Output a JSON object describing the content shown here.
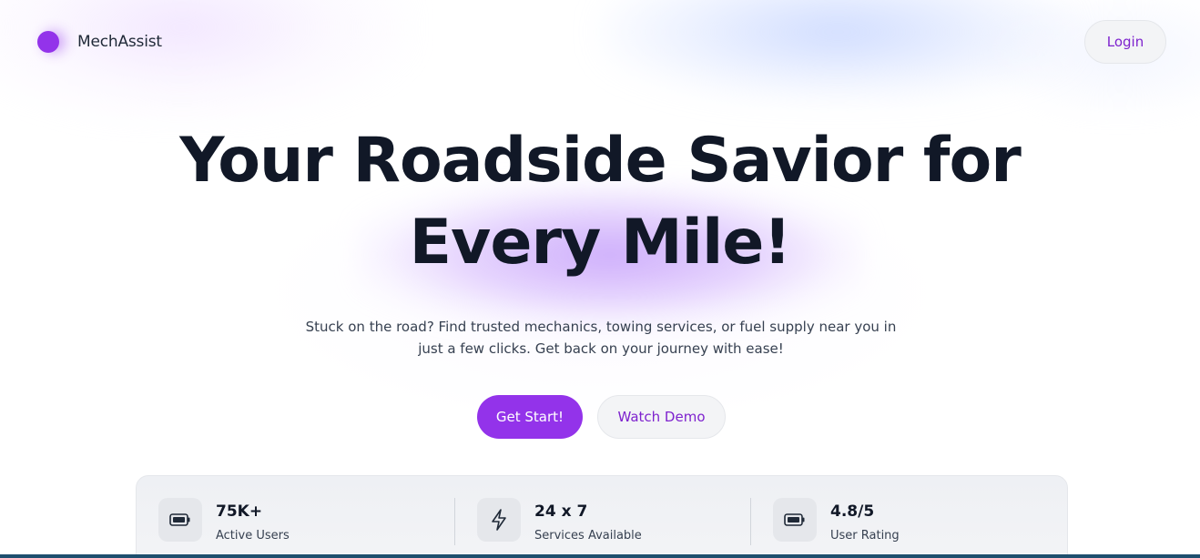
{
  "brand": {
    "name": "MechAssist",
    "accent": "#9333ea"
  },
  "header": {
    "login_label": "Login"
  },
  "hero": {
    "title_line1": "Your Roadside Savior for",
    "title_line2": "Every Mile!",
    "subtitle": "Stuck on the road? Find trusted mechanics, towing services, or fuel supply near you in just a few clicks. Get back on your journey with ease!",
    "primary_cta": "Get Start!",
    "secondary_cta": "Watch Demo"
  },
  "stats": [
    {
      "icon": "battery-icon",
      "value": "75K+",
      "label": "Active Users"
    },
    {
      "icon": "lightning-icon",
      "value": "24 x 7",
      "label": "Services Available"
    },
    {
      "icon": "battery-icon",
      "value": "4.8/5",
      "label": "User Rating"
    }
  ],
  "colors": {
    "text_dark": "#111827",
    "button_purple": "#9333ea",
    "link_purple": "#7e22ce",
    "bottom_bar": "#1e4f6e"
  }
}
